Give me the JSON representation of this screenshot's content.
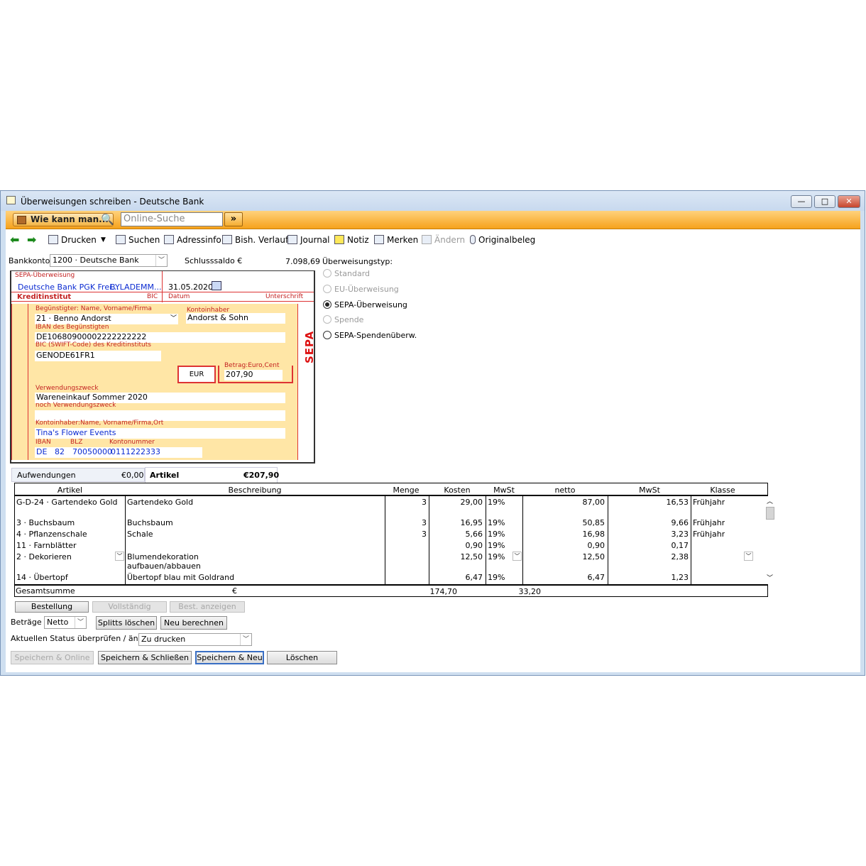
{
  "window": {
    "title": "Überweisungen schreiben - Deutsche Bank"
  },
  "helpbar": {
    "how_label": "Wie kann man...",
    "search_placeholder": "Online-Suche",
    "go_label": "»"
  },
  "toolbar": {
    "print": "Drucken",
    "search": "Suchen",
    "address": "Adressinfo",
    "history": "Bish. Verlauf",
    "journal": "Journal",
    "note": "Notiz",
    "remember": "Merken",
    "change": "Ändern",
    "original": "Originalbeleg"
  },
  "account": {
    "label": "Bankkonto",
    "value": "1200 · Deutsche Bank",
    "balance_label": "Schlusssaldo €",
    "balance": "7.098,69"
  },
  "form": {
    "header": "SEPA-Überweisung",
    "bank_name": "Deutsche Bank PGK Frei...",
    "bank_bic": "BYLADEMM...",
    "date": "31.05.2020",
    "institute_label": "Kreditinstitut",
    "bic_label": "BIC",
    "date_label": "Datum",
    "signature_label": "Unterschrift",
    "payee_label": "Begünstigter: Name, Vorname/Firma",
    "payee": "21 · Benno Andorst",
    "holder_label": "Kontoinhaber",
    "holder": "Andorst & Sohn",
    "iban_label": "IBAN des Begünstigten",
    "iban": "DE10680900002222222222",
    "bic_code_label": "BIC (SWIFT-Code) des Kreditinstituts",
    "bic_code": "GENODE61FR1",
    "currency": "EUR",
    "amount_label": "Betrag:Euro,Cent",
    "amount": "207,90",
    "purpose_label": "Verwendungszweck",
    "purpose": "Wareneinkauf Sommer 2020",
    "purpose2_label": "noch Verwendungszweck",
    "sender_label": "Kontoinhaber:Name, Vorname/Firma,Ort",
    "sender": "Tina's Flower Events",
    "s_iban_label": "IBAN",
    "s_blz_label": "BLZ",
    "s_account_label": "Kontonummer",
    "s_country": "DE",
    "s_check": "82",
    "s_blz": "70050000",
    "s_account": "0111222333",
    "sepa_mark": "SEPA"
  },
  "transfer_type": {
    "label": "Überweisungstyp:",
    "options": [
      "Standard",
      "EU-Überweisung",
      "SEPA-Überweisung",
      "Spende",
      "SEPA-Spendenüberw."
    ],
    "selected": "SEPA-Überweisung"
  },
  "tabs": {
    "expenses": "Aufwendungen",
    "expenses_value": "€0,00",
    "items": "Artikel",
    "items_value": "€207,90"
  },
  "grid": {
    "headers": [
      "Artikel",
      "Beschreibung",
      "Menge",
      "Kosten",
      "MwSt",
      "netto",
      "MwSt",
      "Klasse"
    ],
    "rows": [
      {
        "artikel": "G-D-24 · Gartendeko Gold",
        "beschreibung": "Gartendeko Gold",
        "menge": "3",
        "kosten": "29,00",
        "mwst": "19%",
        "netto": "87,00",
        "mwst_betrag": "16,53",
        "klasse": "Frühjahr"
      },
      {
        "artikel": "3 · Buchsbaum",
        "beschreibung": "Buchsbaum",
        "menge": "3",
        "kosten": "16,95",
        "mwst": "19%",
        "netto": "50,85",
        "mwst_betrag": "9,66",
        "klasse": "Frühjahr"
      },
      {
        "artikel": "4 · Pflanzenschale",
        "beschreibung": "Schale",
        "menge": "3",
        "kosten": "5,66",
        "mwst": "19%",
        "netto": "16,98",
        "mwst_betrag": "3,23",
        "klasse": "Frühjahr"
      },
      {
        "artikel": "11 · Farnblätter",
        "beschreibung": "",
        "menge": "",
        "kosten": "0,90",
        "mwst": "19%",
        "netto": "0,90",
        "mwst_betrag": "0,17",
        "klasse": ""
      },
      {
        "artikel": "2 · Dekorieren",
        "beschreibung": "Blumendekoration",
        "beschreibung2": "aufbauen/abbauen",
        "menge": "",
        "kosten": "12,50",
        "mwst": "19%",
        "netto": "12,50",
        "mwst_betrag": "2,38",
        "klasse": ""
      },
      {
        "artikel": "14 · Übertopf",
        "beschreibung": "Übertopf blau mit Goldrand",
        "menge": "",
        "kosten": "6,47",
        "mwst": "19%",
        "netto": "6,47",
        "mwst_betrag": "1,23",
        "klasse": ""
      }
    ],
    "total_label": "Gesamtsumme",
    "total_currency": "€",
    "total_net": "174,70",
    "total_tax": "33,20"
  },
  "order_buttons": {
    "order": "Bestellung",
    "complete": "Vollständig",
    "show": "Best. anzeigen"
  },
  "amounts": {
    "label": "Beträge",
    "mode": "Netto",
    "delete_splits": "Splitts löschen",
    "recalc": "Neu berechnen"
  },
  "status": {
    "label": "Aktuellen Status überprüfen / ändern",
    "value": "Zu drucken"
  },
  "actions": {
    "save_online": "Speichern & Online",
    "save_close": "Speichern & Schließen",
    "save_new": "Speichern & Neu",
    "delete": "Löschen"
  }
}
